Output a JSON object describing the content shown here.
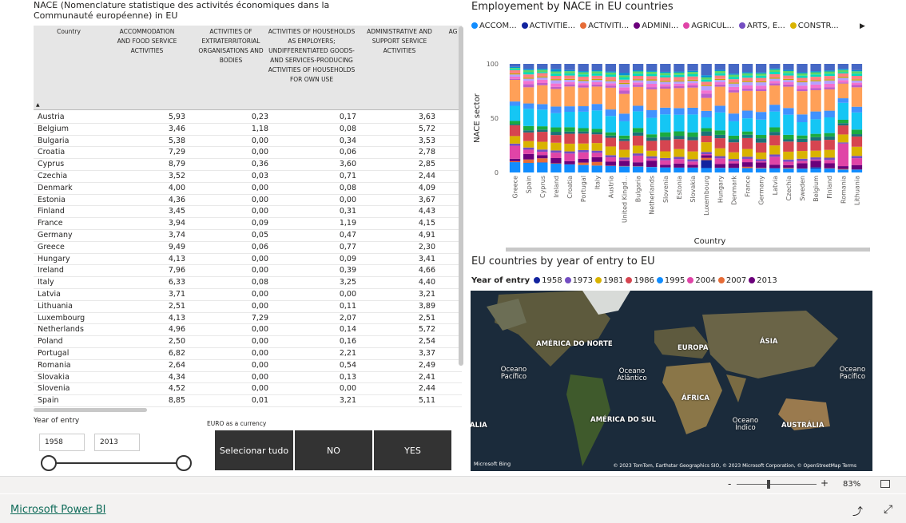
{
  "table": {
    "title": "NACE (Nomenclature statistique des activités économiques dans la Communauté européenne) in EU",
    "columns": [
      "Country",
      "ACCOMMODATION AND FOOD SERVICE ACTIVITIES",
      "ACTIVITIES OF EXTRATERRITORIAL ORGANISATIONS AND BODIES",
      "ACTIVITIES OF HOUSEHOLDS AS EMPLOYERS; UNDIFFERENTIATED GOODS- AND SERVICES-PRODUCING ACTIVITIES OF HOUSEHOLDS FOR OWN USE",
      "ADMINISTRATIVE AND SUPPORT SERVICE ACTIVITIES",
      "AG"
    ],
    "sort_indicator": "▲",
    "rows": [
      [
        "Austria",
        "5,93",
        "0,23",
        "0,17",
        "3,63"
      ],
      [
        "Belgium",
        "3,46",
        "1,18",
        "0,08",
        "5,72"
      ],
      [
        "Bulgaria",
        "5,38",
        "0,00",
        "0,34",
        "3,53"
      ],
      [
        "Croatia",
        "7,29",
        "0,00",
        "0,06",
        "2,78"
      ],
      [
        "Cyprus",
        "8,79",
        "0,36",
        "3,60",
        "2,85"
      ],
      [
        "Czechia",
        "3,52",
        "0,03",
        "0,71",
        "2,44"
      ],
      [
        "Denmark",
        "4,00",
        "0,00",
        "0,08",
        "4,09"
      ],
      [
        "Estonia",
        "4,36",
        "0,00",
        "0,00",
        "3,67"
      ],
      [
        "Finland",
        "3,45",
        "0,00",
        "0,31",
        "4,43"
      ],
      [
        "France",
        "3,94",
        "0,09",
        "1,19",
        "4,15"
      ],
      [
        "Germany",
        "3,74",
        "0,05",
        "0,47",
        "4,91"
      ],
      [
        "Greece",
        "9,49",
        "0,06",
        "0,77",
        "2,30"
      ],
      [
        "Hungary",
        "4,13",
        "0,00",
        "0,09",
        "3,41"
      ],
      [
        "Ireland",
        "7,96",
        "0,00",
        "0,39",
        "4,66"
      ],
      [
        "Italy",
        "6,33",
        "0,08",
        "3,25",
        "4,40"
      ],
      [
        "Latvia",
        "3,71",
        "0,00",
        "0,00",
        "3,21"
      ],
      [
        "Lithuania",
        "2,51",
        "0,00",
        "0,11",
        "3,89"
      ],
      [
        "Luxembourg",
        "4,13",
        "7,29",
        "2,07",
        "2,51"
      ],
      [
        "Netherlands",
        "4,96",
        "0,00",
        "0,14",
        "5,72"
      ],
      [
        "Poland",
        "2,50",
        "0,00",
        "0,16",
        "2,54"
      ],
      [
        "Portugal",
        "6,82",
        "0,00",
        "2,21",
        "3,37"
      ],
      [
        "Romania",
        "2,64",
        "0,00",
        "0,54",
        "2,49"
      ],
      [
        "Slovakia",
        "4,34",
        "0,00",
        "0,13",
        "2,41"
      ],
      [
        "Slovenia",
        "4,52",
        "0,00",
        "0,00",
        "2,44"
      ],
      [
        "Spain",
        "8,85",
        "0,01",
        "3,21",
        "5,11"
      ]
    ]
  },
  "slicers": {
    "year_label": "Year of entry",
    "year_from": "1958",
    "year_to": "2013",
    "currency_label": "EURO as a currency",
    "buttons": [
      "Selecionar tudo",
      "NO",
      "YES"
    ]
  },
  "chart": {
    "title": "Employement by NACE in EU countries",
    "legend": [
      {
        "label": "ACCOM...",
        "color": "#118DFF"
      },
      {
        "label": "ACTIVITIE...",
        "color": "#12239E"
      },
      {
        "label": "ACTIVITI...",
        "color": "#E66C37"
      },
      {
        "label": "ADMINI...",
        "color": "#6B007B"
      },
      {
        "label": "AGRICUL...",
        "color": "#E044A7"
      },
      {
        "label": "ARTS, E...",
        "color": "#744EC2"
      },
      {
        "label": "CONSTR...",
        "color": "#D9B300"
      }
    ],
    "legend_more": "▶",
    "y_axis_label": "NACE sector",
    "x_axis_label": "Country"
  },
  "chart_data": {
    "type": "bar",
    "stacked": true,
    "ylim": [
      0,
      100
    ],
    "yticks": [
      0,
      50,
      100
    ],
    "categories": [
      "Greece",
      "Spain",
      "Cyprus",
      "Ireland",
      "Croatia",
      "Portugal",
      "Italy",
      "Austria",
      "United Kingd...",
      "Bulgaria",
      "Netherlands",
      "Slovenia",
      "Estonia",
      "Slovakia",
      "Luxembourg",
      "Hungary",
      "Denmark",
      "France",
      "Germany",
      "Latvia",
      "Czechia",
      "Sweden",
      "Belgium",
      "Finland",
      "Romania",
      "Lithuania"
    ],
    "segment_colors": [
      "#118DFF",
      "#12239E",
      "#E66C37",
      "#6B007B",
      "#E044A7",
      "#744EC2",
      "#D9B300",
      "#D64550",
      "#197278",
      "#1AAB40",
      "#15C6F4",
      "#4092FF",
      "#FFA058",
      "#BE5DC9",
      "#F472D0",
      "#B5A1FF",
      "#C4A200",
      "#FF8080",
      "#00DBBC",
      "#5BD667",
      "#0091D5",
      "#4668C5"
    ],
    "values": [
      [
        9.5,
        0.1,
        0.8,
        2.3,
        12,
        2,
        7,
        10,
        1,
        3,
        14,
        4,
        20,
        1,
        2,
        2,
        1,
        3,
        1,
        1,
        1,
        2.8
      ],
      [
        8.9,
        0.01,
        3.2,
        5.1,
        4,
        2,
        6,
        8,
        2,
        4,
        16,
        5,
        15,
        3,
        3,
        2,
        1,
        3,
        2,
        2,
        1,
        4.79
      ],
      [
        8.8,
        0.4,
        3.6,
        2.9,
        3,
        2,
        7,
        9,
        2,
        3,
        15,
        5,
        17,
        2,
        3,
        2,
        1,
        3,
        1,
        2,
        1,
        4.3
      ],
      [
        8,
        0,
        0.4,
        4.7,
        5,
        2,
        7,
        7,
        3,
        4,
        13,
        6,
        16,
        2,
        3,
        3,
        1,
        3,
        2,
        2,
        2,
        4.9
      ],
      [
        7.3,
        0,
        0.1,
        2.8,
        7,
        2,
        7,
        9,
        2,
        4,
        14,
        5,
        18,
        2,
        2,
        2,
        1,
        3,
        2,
        2,
        1,
        5.6
      ],
      [
        6.8,
        0,
        2.2,
        3.4,
        6,
        2,
        6,
        9,
        2,
        3,
        15,
        5,
        17,
        2,
        2,
        2,
        1,
        3,
        2,
        2,
        1,
        6.6
      ],
      [
        6.3,
        0.1,
        3.3,
        4.4,
        4,
        2,
        7,
        8,
        2,
        3,
        17,
        6,
        16,
        2,
        2,
        2,
        1,
        3,
        2,
        2,
        1,
        5.9
      ],
      [
        5.9,
        0.2,
        0.2,
        3.6,
        4,
        2,
        8,
        8,
        2,
        3,
        15,
        6,
        20,
        2,
        2,
        2,
        1,
        3,
        2,
        2,
        1,
        6.9
      ],
      [
        5.5,
        0.1,
        0.3,
        4.8,
        1,
        2,
        7,
        8,
        2,
        3,
        13,
        7,
        18,
        3,
        3,
        3,
        1,
        3,
        2,
        2,
        2,
        8.4
      ],
      [
        5.4,
        0,
        0.3,
        3.5,
        6,
        2,
        7,
        9,
        3,
        4,
        15,
        5,
        17,
        2,
        2,
        2,
        1,
        3,
        2,
        2,
        1,
        5.8
      ],
      [
        5,
        0,
        0.1,
        5.7,
        2,
        2,
        5,
        9,
        3,
        3,
        15,
        7,
        19,
        2,
        3,
        3,
        1,
        3,
        2,
        2,
        1,
        6.2
      ],
      [
        4.5,
        0,
        0,
        2.4,
        4,
        2,
        6,
        10,
        3,
        4,
        16,
        6,
        17,
        2,
        2,
        2,
        1,
        3,
        2,
        2,
        1,
        7.1
      ],
      [
        4.4,
        0,
        0,
        3.7,
        4,
        2,
        7,
        9,
        3,
        4,
        15,
        6,
        18,
        2,
        2,
        2,
        1,
        3,
        2,
        2,
        1,
        6.9
      ],
      [
        4.3,
        0,
        0.1,
        2.4,
        3,
        2,
        7,
        10,
        3,
        4,
        16,
        6,
        18,
        2,
        2,
        2,
        1,
        3,
        2,
        2,
        1,
        6.2
      ],
      [
        4.1,
        7.3,
        2.1,
        2.5,
        1,
        2,
        9,
        6,
        4,
        3,
        10,
        6,
        12,
        4,
        3,
        4,
        1,
        3,
        2,
        2,
        2,
        10.5
      ],
      [
        4.1,
        0,
        0.1,
        3.4,
        5,
        2,
        7,
        9,
        3,
        4,
        16,
        6,
        17,
        2,
        2,
        2,
        1,
        3,
        2,
        2,
        1,
        5.4
      ],
      [
        4,
        0,
        0.1,
        4.1,
        2,
        2,
        6,
        9,
        3,
        3,
        13,
        7,
        19,
        2,
        3,
        3,
        1,
        3,
        2,
        2,
        1,
        8.8
      ],
      [
        3.9,
        0.1,
        1.2,
        4.2,
        3,
        2,
        7,
        10,
        3,
        3,
        12,
        7,
        18,
        2,
        3,
        3,
        1,
        3,
        2,
        2,
        1,
        7.6
      ],
      [
        3.7,
        0.1,
        0.5,
        4.9,
        1,
        2,
        6,
        9,
        4,
        3,
        14,
        7,
        19,
        2,
        3,
        3,
        1,
        3,
        2,
        2,
        1,
        7.8
      ],
      [
        3.7,
        0,
        0,
        3.2,
        7,
        2,
        8,
        9,
        3,
        4,
        14,
        6,
        17,
        2,
        2,
        2,
        1,
        3,
        2,
        2,
        1,
        4.1
      ],
      [
        3.5,
        0,
        0.7,
        2.4,
        3,
        2,
        7,
        9,
        2,
        4,
        18,
        6,
        19,
        2,
        2,
        2,
        1,
        3,
        2,
        2,
        1,
        5.4
      ],
      [
        3.4,
        0.1,
        0.1,
        4.8,
        2,
        2,
        7,
        8,
        3,
        3,
        12,
        7,
        21,
        2,
        3,
        3,
        1,
        3,
        2,
        2,
        1,
        7.6
      ],
      [
        3.5,
        1.2,
        0.1,
        5.7,
        1,
        2,
        6,
        9,
        3,
        3,
        13,
        7,
        19,
        2,
        3,
        3,
        1,
        3,
        2,
        2,
        1,
        6.5
      ],
      [
        3.5,
        0,
        0.3,
        4.4,
        3,
        2,
        7,
        9,
        3,
        3,
        14,
        6,
        19,
        2,
        3,
        3,
        1,
        3,
        2,
        2,
        1,
        5.8
      ],
      [
        2.6,
        0,
        0.5,
        2.5,
        20,
        1,
        7,
        8,
        2,
        3,
        15,
        4,
        13,
        1,
        2,
        2,
        1,
        3,
        1,
        2,
        1,
        4.4
      ],
      [
        2.5,
        0,
        0.1,
        3.9,
        6,
        2,
        8,
        9,
        2,
        4,
        15,
        5,
        17,
        2,
        2,
        2,
        1,
        3,
        2,
        2,
        1,
        5.5
      ]
    ]
  },
  "map": {
    "title": "EU countries by year of entry to EU",
    "legend_title": "Year of entry",
    "legend": [
      {
        "label": "1958",
        "color": "#12239E"
      },
      {
        "label": "1973",
        "color": "#744EC2"
      },
      {
        "label": "1981",
        "color": "#D9B300"
      },
      {
        "label": "1986",
        "color": "#D64550"
      },
      {
        "label": "1995",
        "color": "#118DFF"
      },
      {
        "label": "2004",
        "color": "#E044A7"
      },
      {
        "label": "2007",
        "color": "#E66C37"
      },
      {
        "label": "2013",
        "color": "#6B007B"
      }
    ],
    "labels": {
      "north_america": "AMÉRICA DO NORTE",
      "europe": "EUROPA",
      "asia": "ÁSIA",
      "pacific_left": "Oceano Pacífico",
      "atlantic": "Oceano Atlântico",
      "pacific_right": "Oceano Pacífico",
      "africa": "ÁFRICA",
      "south_america": "AMÉRICA DO SUL",
      "indian": "Oceano Índico",
      "australia": "AUSTRÁLIA",
      "lia": "ALIA"
    },
    "provider": "Microsoft Bing",
    "credit": "© 2023 TomTom, Earthstar Geographics SIO, © 2023 Microsoft Corporation, © OpenStreetMap  Terms"
  },
  "status": {
    "zoom_minus": "-",
    "zoom_plus": "+",
    "zoom": "83%",
    "brand": "Microsoft Power BI",
    "share_icon": "share-icon",
    "expand_icon": "expand-icon"
  }
}
